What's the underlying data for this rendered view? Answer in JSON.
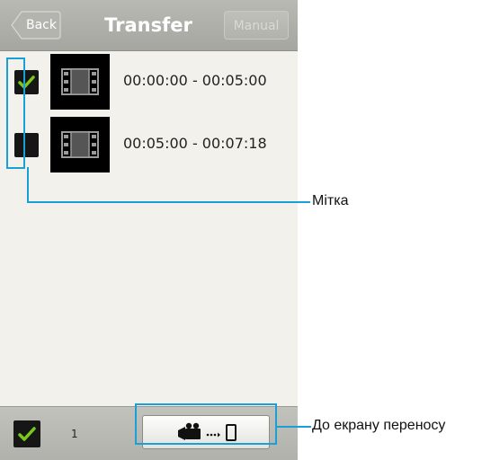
{
  "header": {
    "back_label": "Back",
    "title": "Transfer",
    "manual_label": "Manual"
  },
  "clips": [
    {
      "range": "00:00:00 - 00:05:00",
      "checked": true,
      "thumb_icon": "film-icon"
    },
    {
      "range": "00:05:00 - 00:07:18",
      "checked": false,
      "thumb_icon": "film-icon"
    }
  ],
  "footer": {
    "select_all_checked": true,
    "selected_count": "1",
    "transfer_button_icons": [
      "video-camera-icon",
      "dots-icon",
      "phone-icon"
    ]
  },
  "callouts": {
    "checkmark_label": "Мітка",
    "transfer_label": "До екрану переносу"
  },
  "colors": {
    "highlight": "#19a0d6",
    "check_green": "#7bc91c",
    "header_gray": "#a9a9a4"
  }
}
